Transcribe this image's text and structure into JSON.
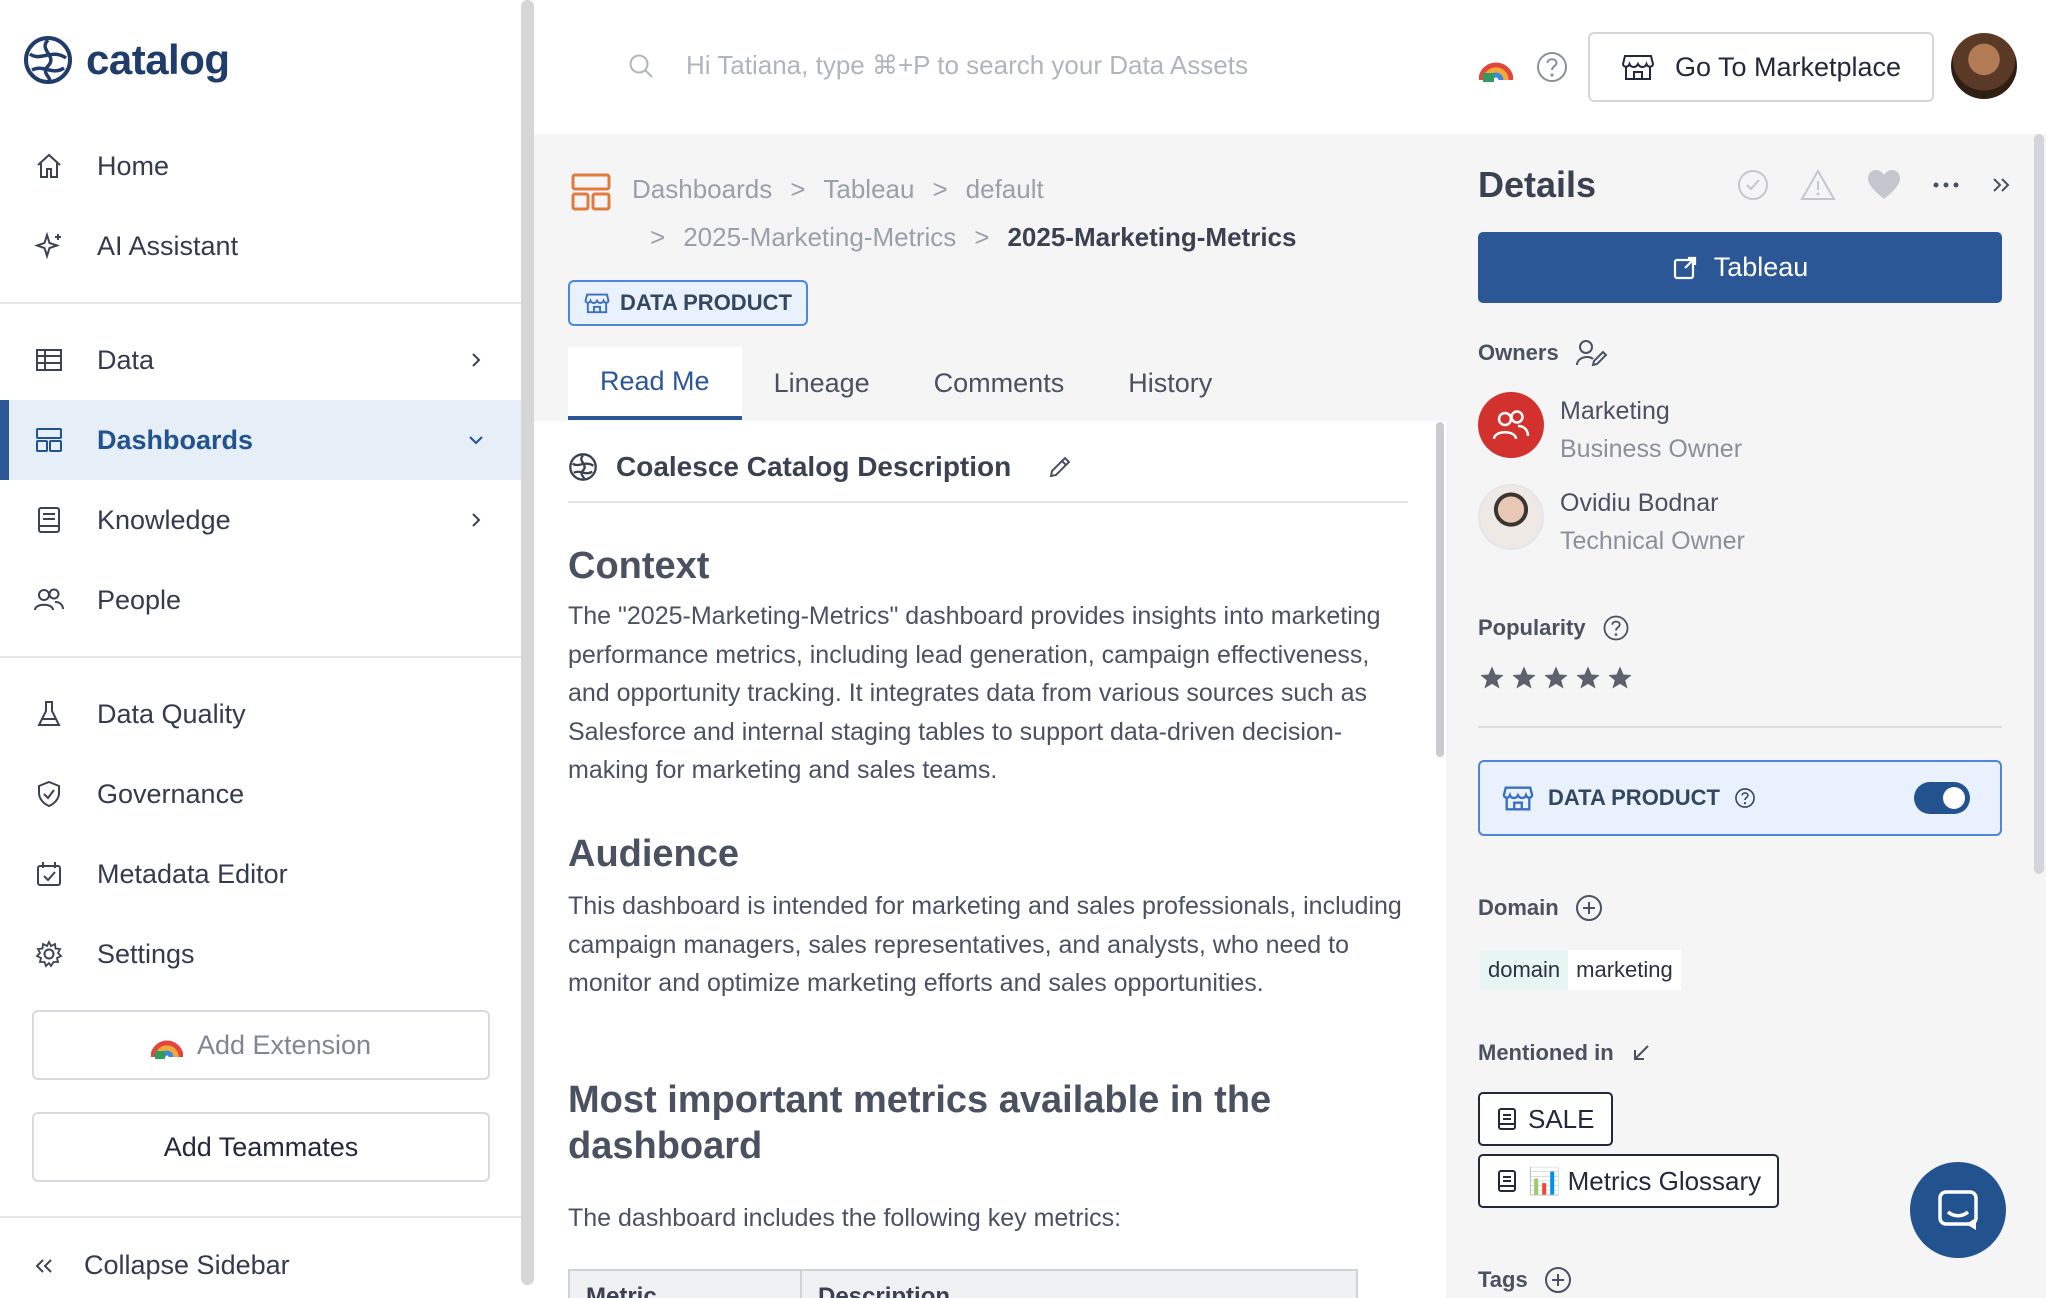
{
  "app": {
    "name": "catalog"
  },
  "sidebar": {
    "primary": [
      {
        "label": "Home",
        "icon": "home-icon"
      },
      {
        "label": "AI Assistant",
        "icon": "sparkle-icon"
      }
    ],
    "sections": [
      {
        "label": "Data",
        "icon": "table-icon",
        "expandable": true
      },
      {
        "label": "Dashboards",
        "icon": "dashboard-icon",
        "expandable": true,
        "active": true
      },
      {
        "label": "Knowledge",
        "icon": "book-icon",
        "expandable": true
      },
      {
        "label": "People",
        "icon": "people-icon"
      }
    ],
    "tools": [
      {
        "label": "Data Quality",
        "icon": "flask-icon"
      },
      {
        "label": "Governance",
        "icon": "shield-icon"
      },
      {
        "label": "Metadata Editor",
        "icon": "calendar-check-icon"
      },
      {
        "label": "Settings",
        "icon": "gear-icon"
      }
    ],
    "add_extension": "Add Extension",
    "add_teammates": "Add Teammates",
    "collapse": "Collapse Sidebar"
  },
  "topbar": {
    "search_placeholder": "Hi Tatiana, type ⌘+P to search your Data Assets",
    "marketplace_button": "Go To Marketplace"
  },
  "breadcrumb": {
    "row1": [
      "Dashboards",
      "Tableau",
      "default"
    ],
    "row2": [
      "2025-Marketing-Metrics"
    ],
    "current": "2025-Marketing-Metrics",
    "separator": ">"
  },
  "badge": "DATA PRODUCT",
  "tabs": [
    {
      "label": "Read Me",
      "active": true
    },
    {
      "label": "Lineage"
    },
    {
      "label": "Comments"
    },
    {
      "label": "History"
    }
  ],
  "readme": {
    "heading": "Coalesce Catalog Description",
    "sections": [
      {
        "title": "Context",
        "body": "The \"2025-Marketing-Metrics\" dashboard provides insights into marketing performance metrics, including lead generation, campaign effectiveness, and opportunity tracking. It integrates data from various sources such as Salesforce and internal staging tables to support data-driven decision-making for marketing and sales teams."
      },
      {
        "title": "Audience",
        "body": "This dashboard is intended for marketing and sales professionals, including campaign managers, sales representatives, and analysts, who need to monitor and optimize marketing efforts and sales opportunities."
      },
      {
        "title": "Most important metrics available in the dashboard",
        "body": "The dashboard includes the following key metrics:"
      }
    ],
    "table_headers": [
      "Metric",
      "Description"
    ]
  },
  "details": {
    "title": "Details",
    "open_button": "Tableau",
    "owners_label": "Owners",
    "owners": [
      {
        "name": "Marketing",
        "role": "Business Owner"
      },
      {
        "name": "Ovidiu Bodnar",
        "role": "Technical Owner"
      }
    ],
    "popularity_label": "Popularity",
    "popularity_stars": 5,
    "data_product_label": "DATA PRODUCT",
    "data_product_enabled": true,
    "domain_label": "Domain",
    "domain_tag": {
      "key": "domain",
      "value": "marketing"
    },
    "mentioned_label": "Mentioned in",
    "mentioned": [
      {
        "label": "SALE"
      },
      {
        "label": "📊 Metrics Glossary"
      }
    ],
    "tags_label": "Tags"
  },
  "colors": {
    "brand": "#1f3c6b",
    "accent": "#2b5797",
    "active_bg": "#e6eef8",
    "badge_border": "#4f86d9"
  }
}
